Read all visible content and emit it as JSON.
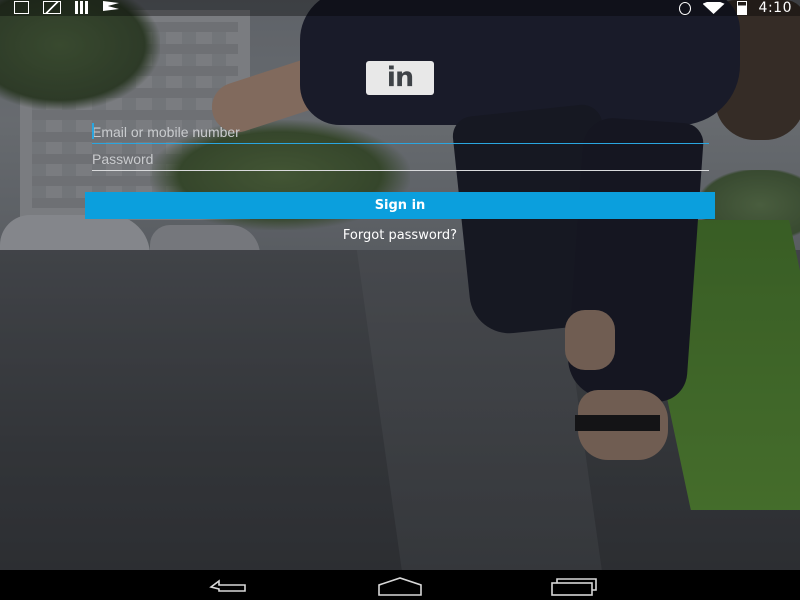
{
  "status_bar": {
    "time": "4:10",
    "left_icons": [
      "download-icon",
      "gallery-icon",
      "signal-bars-icon",
      "flag-icon"
    ],
    "right_icons": [
      "bluetooth-icon",
      "wifi-icon",
      "battery-charging-icon"
    ]
  },
  "login": {
    "logo_text": "in",
    "email_placeholder": "Email or mobile number",
    "email_value": "",
    "password_placeholder": "Password",
    "password_value": "",
    "sign_in_label": "Sign in",
    "forgot_password_label": "Forgot password?"
  },
  "colors": {
    "accent": "#0b9fdd",
    "focus_underline": "#2aa6e0"
  },
  "nav_bar": {
    "buttons": [
      "back-icon",
      "home-icon",
      "recents-icon"
    ]
  }
}
